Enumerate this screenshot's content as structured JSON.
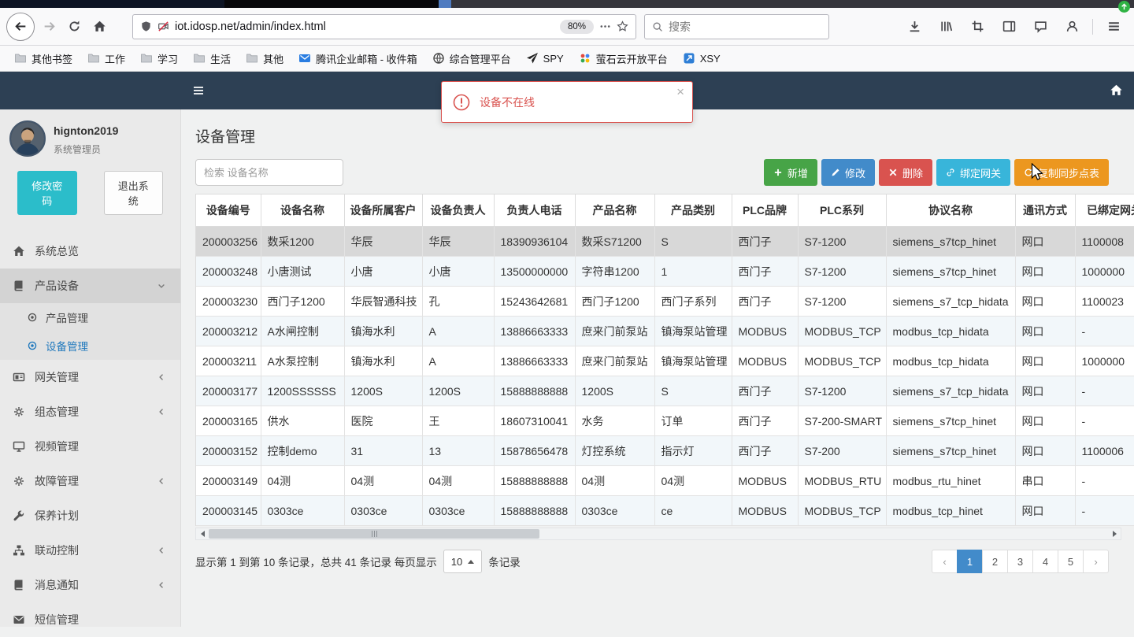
{
  "browser": {
    "url_domain": "iot.idosp.net",
    "url_path": "/admin/index.html",
    "zoom_level": "80%",
    "search_placeholder": "搜索",
    "bookmarks": [
      {
        "label": "其他书签",
        "icon": "folder"
      },
      {
        "label": "工作",
        "icon": "folder"
      },
      {
        "label": "学习",
        "icon": "folder"
      },
      {
        "label": "生活",
        "icon": "folder"
      },
      {
        "label": "其他",
        "icon": "folder"
      },
      {
        "label": "腾讯企业邮箱 - 收件箱",
        "icon": "tencent-mail"
      },
      {
        "label": "综合管理平台",
        "icon": "globe"
      },
      {
        "label": "SPY",
        "icon": "plane"
      },
      {
        "label": "萤石云开放平台",
        "icon": "ezviz-dots"
      },
      {
        "label": "XSY",
        "icon": "xsy"
      }
    ]
  },
  "alert": {
    "message": "设备不在线",
    "close_glyph": "×"
  },
  "sidebar": {
    "user": {
      "name": "hignton2019",
      "role": "系统管理员"
    },
    "change_password": "修改密码",
    "logout": "退出系统",
    "menu": [
      {
        "label": "系统总览",
        "name": "system-overview",
        "icon": "home"
      },
      {
        "label": "产品设备",
        "name": "product-device",
        "icon": "book",
        "open": true,
        "chevron": "down"
      },
      {
        "label": "产品管理",
        "name": "product-management",
        "icon": "circle-dot",
        "sub": true
      },
      {
        "label": "设备管理",
        "name": "device-management",
        "icon": "circle-dot",
        "sub": true,
        "active": true
      },
      {
        "label": "网关管理",
        "name": "gateway-management",
        "icon": "card",
        "chevron": "left"
      },
      {
        "label": "组态管理",
        "name": "configuration-management",
        "icon": "gears",
        "chevron": "left"
      },
      {
        "label": "视频管理",
        "name": "video-management",
        "icon": "monitor"
      },
      {
        "label": "故障管理",
        "name": "fault-management",
        "icon": "gears",
        "chevron": "left"
      },
      {
        "label": "保养计划",
        "name": "maintenance-plan",
        "icon": "wrench"
      },
      {
        "label": "联动控制",
        "name": "linkage-control",
        "icon": "sitemap",
        "chevron": "left"
      },
      {
        "label": "消息通知",
        "name": "message-notification",
        "icon": "book",
        "chevron": "left"
      },
      {
        "label": "短信管理",
        "name": "sms-management",
        "icon": "envelope"
      }
    ]
  },
  "main": {
    "title": "设备管理",
    "search_placeholder": "检索 设备名称",
    "buttons": [
      {
        "label": "新增",
        "name": "add-button",
        "icon": "plus",
        "color": "#47a447"
      },
      {
        "label": "修改",
        "name": "edit-button",
        "icon": "pencil",
        "color": "#428bca"
      },
      {
        "label": "删除",
        "name": "delete-button",
        "icon": "cross",
        "color": "#d9534f"
      },
      {
        "label": "绑定网关",
        "name": "bind-gateway-button",
        "icon": "link",
        "color": "#38b5da"
      },
      {
        "label": "复制同步点表",
        "name": "copy-sync-points-button",
        "icon": "refresh",
        "color": "#ec971f"
      }
    ],
    "table": {
      "columns": [
        "设备编号",
        "设备名称",
        "设备所属客户",
        "设备负责人",
        "负责人电话",
        "产品名称",
        "产品类别",
        "PLC品牌",
        "PLC系列",
        "协议名称",
        "通讯方式",
        "已绑定网关"
      ],
      "selected_row": 0,
      "rows": [
        [
          "200003256",
          "数采1200",
          "华辰",
          "华辰",
          "18390936104",
          "数采S71200",
          "S",
          "西门子",
          "S7-1200",
          "siemens_s7tcp_hinet",
          "网口",
          "1100008"
        ],
        [
          "200003248",
          "小唐测试",
          "小唐",
          "小唐",
          "13500000000",
          "字符串1200",
          "1",
          "西门子",
          "S7-1200",
          "siemens_s7tcp_hinet",
          "网口",
          "1000000"
        ],
        [
          "200003230",
          "西门子1200",
          "华辰智通科技",
          "孔",
          "15243642681",
          "西门子1200",
          "西门子系列",
          "西门子",
          "S7-1200",
          "siemens_s7_tcp_hidata",
          "网口",
          "1100023"
        ],
        [
          "200003212",
          "A水闸控制",
          "镇海水利",
          "A",
          "13886663333",
          "庶来门前泵站",
          "镇海泵站管理",
          "MODBUS",
          "MODBUS_TCP",
          "modbus_tcp_hidata",
          "网口",
          "-"
        ],
        [
          "200003211",
          "A水泵控制",
          "镇海水利",
          "A",
          "13886663333",
          "庶来门前泵站",
          "镇海泵站管理",
          "MODBUS",
          "MODBUS_TCP",
          "modbus_tcp_hidata",
          "网口",
          "1000000"
        ],
        [
          "200003177",
          "1200SSSSSS",
          "1200S",
          "1200S",
          "15888888888",
          "1200S",
          "S",
          "西门子",
          "S7-1200",
          "siemens_s7_tcp_hidata",
          "网口",
          "-"
        ],
        [
          "200003165",
          "供水",
          "医院",
          "王",
          "18607310041",
          "水务",
          "订单",
          "西门子",
          "S7-200-SMART",
          "siemens_s7tcp_hinet",
          "网口",
          "-"
        ],
        [
          "200003152",
          "控制demo",
          "31",
          "13",
          "15878656478",
          "灯控系统",
          "指示灯",
          "西门子",
          "S7-200",
          "siemens_s7tcp_hinet",
          "网口",
          "1100006"
        ],
        [
          "200003149",
          "04测",
          "04测",
          "04测",
          "15888888888",
          "04测",
          "04测",
          "MODBUS",
          "MODBUS_RTU",
          "modbus_rtu_hinet",
          "串口",
          "-"
        ],
        [
          "200003145",
          "0303ce",
          "0303ce",
          "0303ce",
          "15888888888",
          "0303ce",
          "ce",
          "MODBUS",
          "MODBUS_TCP",
          "modbus_tcp_hinet",
          "网口",
          "-"
        ]
      ]
    },
    "pagination": {
      "summary_a": "显示第 1 到第 10 条记录，总共 41 条记录 每页显示",
      "page_size": "10",
      "summary_b": "条记录",
      "prev": "‹",
      "next": "›",
      "pages": [
        "1",
        "2",
        "3",
        "4",
        "5"
      ],
      "active_page": "1"
    }
  },
  "colors": {
    "app_header": "#2d4054",
    "accent_blue": "#428bca",
    "alert_red": "#d9534f"
  }
}
